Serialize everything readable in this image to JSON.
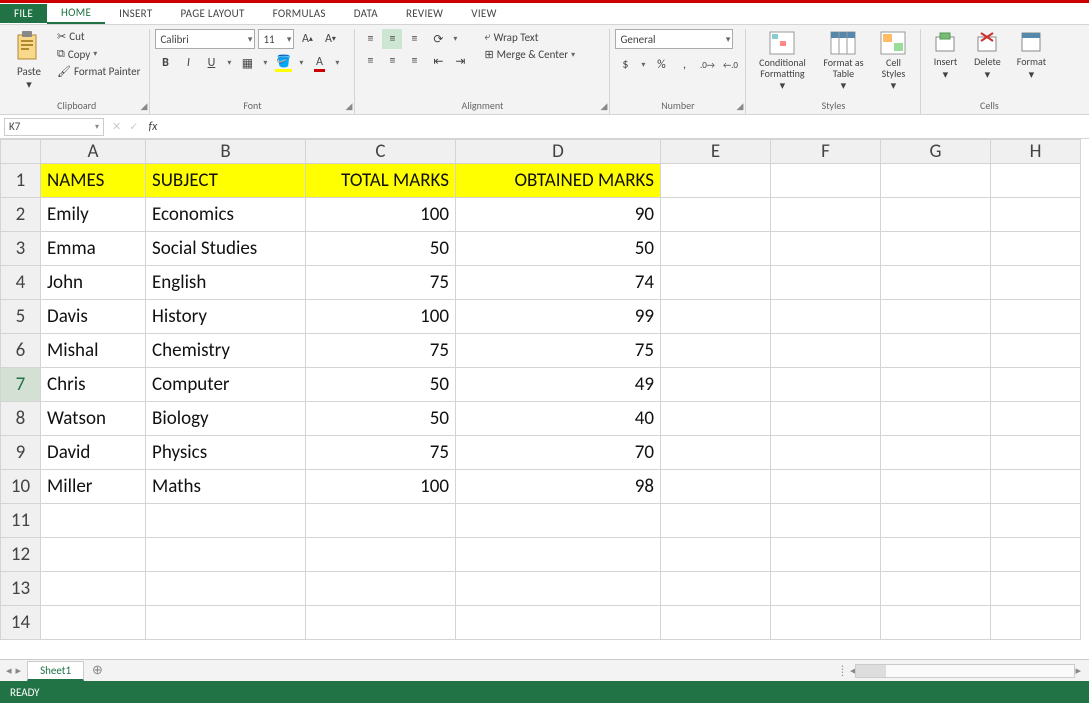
{
  "tabs": {
    "file": "FILE",
    "home": "HOME",
    "insert": "INSERT",
    "page_layout": "PAGE LAYOUT",
    "formulas": "FORMULAS",
    "data": "DATA",
    "review": "REVIEW",
    "view": "VIEW"
  },
  "ribbon": {
    "clipboard": {
      "paste": "Paste",
      "cut": "Cut",
      "copy": "Copy",
      "format_painter": "Format Painter",
      "label": "Clipboard"
    },
    "font": {
      "name": "Calibri",
      "size": "11",
      "label": "Font"
    },
    "alignment": {
      "wrap": "Wrap Text",
      "merge": "Merge & Center",
      "label": "Alignment"
    },
    "number": {
      "format": "General",
      "label": "Number"
    },
    "styles": {
      "cond": "Conditional Formatting",
      "table": "Format as Table",
      "cell": "Cell Styles",
      "label": "Styles"
    },
    "cells": {
      "insert": "Insert",
      "delete": "Delete",
      "format": "Format",
      "label": "Cells"
    }
  },
  "namebox": "K7",
  "formula": "",
  "columns": [
    "A",
    "B",
    "C",
    "D",
    "E",
    "F",
    "G",
    "H"
  ],
  "headers": {
    "a": "NAMES",
    "b": "SUBJECT",
    "c": "TOTAL MARKS",
    "d": "OBTAINED MARKS"
  },
  "rows": [
    {
      "n": "2",
      "a": "Emily",
      "b": "Economics",
      "c": "100",
      "d": "90"
    },
    {
      "n": "3",
      "a": "Emma",
      "b": "Social Studies",
      "c": "50",
      "d": "50"
    },
    {
      "n": "4",
      "a": "John",
      "b": "English",
      "c": "75",
      "d": "74"
    },
    {
      "n": "5",
      "a": "Davis",
      "b": "History",
      "c": "100",
      "d": "99"
    },
    {
      "n": "6",
      "a": "Mishal",
      "b": "Chemistry",
      "c": "75",
      "d": "75"
    },
    {
      "n": "7",
      "a": "Chris",
      "b": "Computer",
      "c": "50",
      "d": "49"
    },
    {
      "n": "8",
      "a": "Watson",
      "b": "Biology",
      "c": "50",
      "d": "40"
    },
    {
      "n": "9",
      "a": "David",
      "b": "Physics",
      "c": "75",
      "d": "70"
    },
    {
      "n": "10",
      "a": "Miller",
      "b": "Maths",
      "c": "100",
      "d": "98"
    }
  ],
  "empty_rows": [
    "11",
    "12",
    "13",
    "14"
  ],
  "sheet_tab": "Sheet1",
  "status": "READY"
}
